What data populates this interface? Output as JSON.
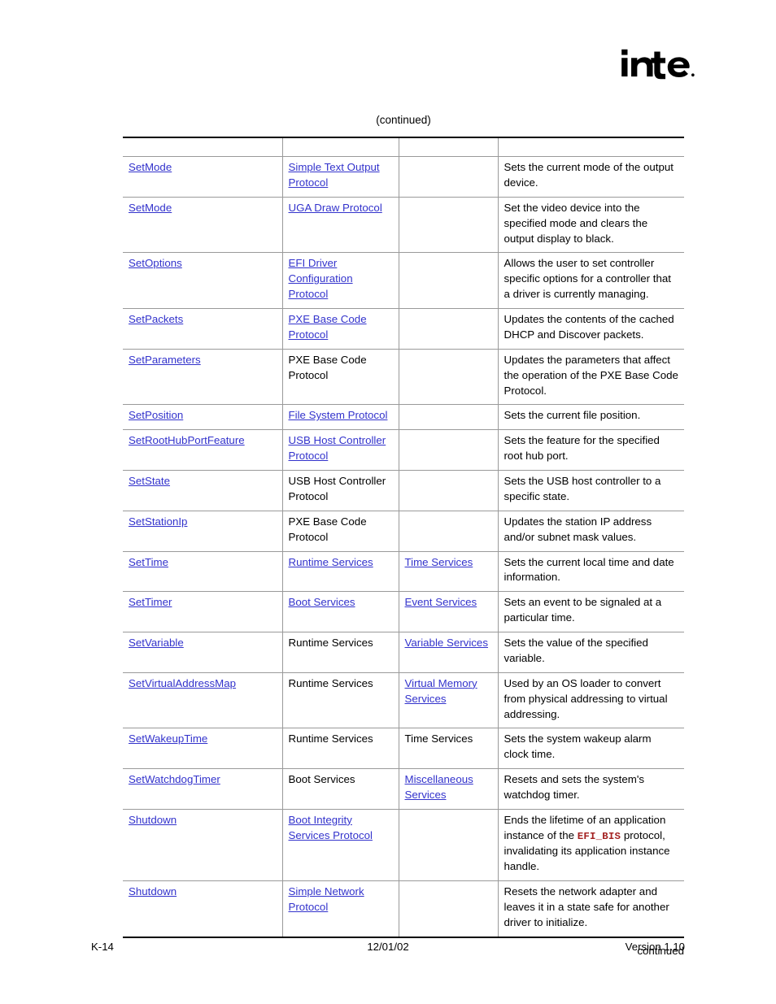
{
  "brand": {
    "logo_text": "intel",
    "logo_name": "intel-logo"
  },
  "heading": {
    "continued_label": "(continued)"
  },
  "table": {
    "columns": [
      "",
      "",
      "",
      ""
    ],
    "rows": [
      {
        "name": "SetMode",
        "name_link": true,
        "col2": "Simple Text Output Protocol",
        "col2_link": true,
        "col3": "",
        "col3_link": false,
        "desc": "Sets the current mode of the output device."
      },
      {
        "name": "SetMode",
        "name_link": true,
        "col2": "UGA Draw Protocol",
        "col2_link": true,
        "col3": "",
        "col3_link": false,
        "desc": "Set the video device into the specified mode and clears the output display to black."
      },
      {
        "name": "SetOptions",
        "name_link": true,
        "col2": "EFI Driver Configuration Protocol",
        "col2_link": true,
        "col3": "",
        "col3_link": false,
        "desc": "Allows the user to set controller specific options for a controller that a driver is currently managing."
      },
      {
        "name": "SetPackets",
        "name_link": true,
        "col2": "PXE Base Code Protocol",
        "col2_link": true,
        "col3": "",
        "col3_link": false,
        "desc": "Updates the contents of the cached DHCP and Discover packets."
      },
      {
        "name": "SetParameters",
        "name_link": true,
        "col2": "PXE Base Code Protocol",
        "col2_link": false,
        "col3": "",
        "col3_link": false,
        "desc": "Updates the parameters that affect the operation of the PXE Base Code Protocol."
      },
      {
        "name": "SetPosition",
        "name_link": true,
        "col2": "File System Protocol",
        "col2_link": true,
        "col3": "",
        "col3_link": false,
        "desc": "Sets the current file position."
      },
      {
        "name": "SetRootHubPortFeature",
        "name_link": true,
        "col2": "USB Host Controller Protocol",
        "col2_link": true,
        "col3": "",
        "col3_link": false,
        "desc": "Sets the feature for the specified root hub port."
      },
      {
        "name": "SetState",
        "name_link": true,
        "col2": "USB Host Controller Protocol",
        "col2_link": false,
        "col3": "",
        "col3_link": false,
        "desc": "Sets the USB host controller to a specific state."
      },
      {
        "name": "SetStationIp",
        "name_link": true,
        "col2": "PXE Base Code Protocol",
        "col2_link": false,
        "col3": "",
        "col3_link": false,
        "desc": "Updates the station IP address and/or subnet mask values."
      },
      {
        "name": "SetTime",
        "name_link": true,
        "col2": "Runtime Services",
        "col2_link": true,
        "col3": "Time Services",
        "col3_link": true,
        "desc": "Sets the current local time and date information."
      },
      {
        "name": "SetTimer",
        "name_link": true,
        "col2": "Boot Services",
        "col2_link": true,
        "col3": "Event Services",
        "col3_link": true,
        "desc": "Sets an event to be signaled at a particular time."
      },
      {
        "name": "SetVariable",
        "name_link": true,
        "col2": "Runtime Services",
        "col2_link": false,
        "col3": "Variable Services",
        "col3_link": true,
        "desc": "Sets the value of the specified variable."
      },
      {
        "name": "SetVirtualAddressMap",
        "name_link": true,
        "col2": "Runtime Services",
        "col2_link": false,
        "col3": "Virtual Memory Services",
        "col3_link": true,
        "desc": "Used by an OS loader to convert from physical addressing to virtual addressing."
      },
      {
        "name": "SetWakeupTime",
        "name_link": true,
        "col2": "Runtime Services",
        "col2_link": false,
        "col3": "Time Services",
        "col3_link": false,
        "desc": "Sets the system wakeup alarm clock time."
      },
      {
        "name": "SetWatchdogTimer",
        "name_link": true,
        "col2": "Boot Services",
        "col2_link": false,
        "col3": "Miscellaneous Services",
        "col3_link": true,
        "desc": "Resets and sets the system's watchdog timer."
      },
      {
        "name": "Shutdown",
        "name_link": true,
        "col2": "Boot Integrity Services Protocol",
        "col2_link": true,
        "col3": "",
        "col3_link": false,
        "desc_parts": [
          {
            "text": "Ends the lifetime of an application instance of the ",
            "code": false
          },
          {
            "text": "EFI_BIS",
            "code": true
          },
          {
            "text": " protocol, invalidating its application instance handle.",
            "code": false
          }
        ],
        "desc": "Ends the lifetime of an application instance of the EFI_BIS protocol, invalidating its application instance handle."
      },
      {
        "name": "Shutdown",
        "name_link": true,
        "col2": "Simple Network Protocol",
        "col2_link": true,
        "col3": "",
        "col3_link": false,
        "desc": "Resets the network adapter and leaves it in a state safe for another driver to initialize."
      }
    ]
  },
  "table_footer": {
    "continued_label": "continued"
  },
  "footer": {
    "page_number": "K-14",
    "date": "12/01/02",
    "version": "Version 1.10"
  },
  "colors": {
    "link": "#3333CC",
    "code": "#A32020",
    "rule": "#9A9A9A",
    "heavy_rule": "#000000"
  }
}
